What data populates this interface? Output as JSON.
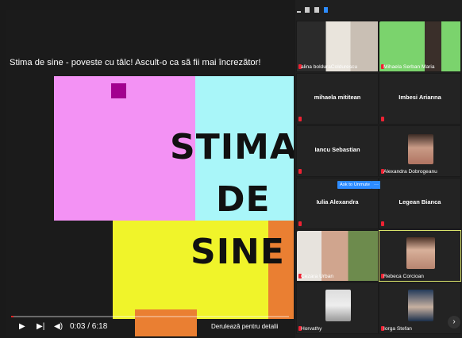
{
  "video": {
    "title": "Stima de sine - poveste cu tâlc! Ascult-o ca să fii mai încrezător!",
    "slide_words": [
      "STIMA",
      "DE",
      "SINE"
    ],
    "time": "0:03 / 6:18",
    "progress": 0.008,
    "hint": "Derulează pentru detalii",
    "colors": {
      "pink": "#f392f4",
      "cyan": "#a9f6f9",
      "yellow": "#f0f42a",
      "orange": "#ea7f32",
      "magenta": "#a2008f"
    }
  },
  "panel": {
    "ask_unmute_label": "Ask to Unmute",
    "ask_more_label": "···",
    "next_label": "›"
  },
  "participants": [
    {
      "name": "alina boldura Coldurescu",
      "video": true,
      "label_short": "alina bolduraColdurescu"
    },
    {
      "name": "Mihaela Serban Maria",
      "video": true
    },
    {
      "name": "mihaela mititean",
      "video": false
    },
    {
      "name": "Imbesi Arianna",
      "video": false
    },
    {
      "name": "Iancu Sebastian",
      "video": false
    },
    {
      "name": "Alexandra Dobrogeanu",
      "video": true
    },
    {
      "name": "Iulia Alexandra",
      "video": false
    },
    {
      "name": "Legean Bianca",
      "video": false
    },
    {
      "name": "Cezara Urban",
      "video": true
    },
    {
      "name": "Rebeca Corcioan",
      "video": true
    },
    {
      "name": "Horvathy",
      "video": true
    },
    {
      "name": "Iorga Stefan",
      "video": true
    }
  ]
}
